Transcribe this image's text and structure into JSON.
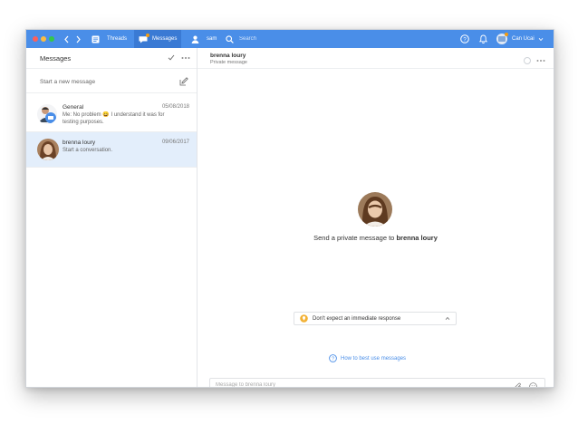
{
  "titlebar": {
    "nav": [
      {
        "label": "Threads"
      },
      {
        "label": "Messages"
      },
      {
        "label": "sam"
      }
    ],
    "search_placeholder": "Search",
    "account_label": "Can Ucai"
  },
  "sidebar": {
    "title": "Messages",
    "new_message_label": "Start a new message",
    "conversations": [
      {
        "name": "General",
        "date": "05/08/2018",
        "preview": "Me: No problem 😄 I understand it was for testing purposes."
      },
      {
        "name": "brenna loury",
        "date": "09/06/2017",
        "preview": "Start a conversation."
      }
    ]
  },
  "conversation": {
    "name": "brenna loury",
    "subtitle": "Private message",
    "prompt_prefix": "Send a private message to ",
    "prompt_name": "brenna loury",
    "expectation_label": "Don't expect an immediate response",
    "help_link": "How to best use messages",
    "composer_placeholder": "Message to brenna loury"
  },
  "colors": {
    "titlebar": "#4a8ee8",
    "selected_row": "#e3eefb",
    "link": "#4a8ee8",
    "notice_bulb": "#f2b134"
  }
}
